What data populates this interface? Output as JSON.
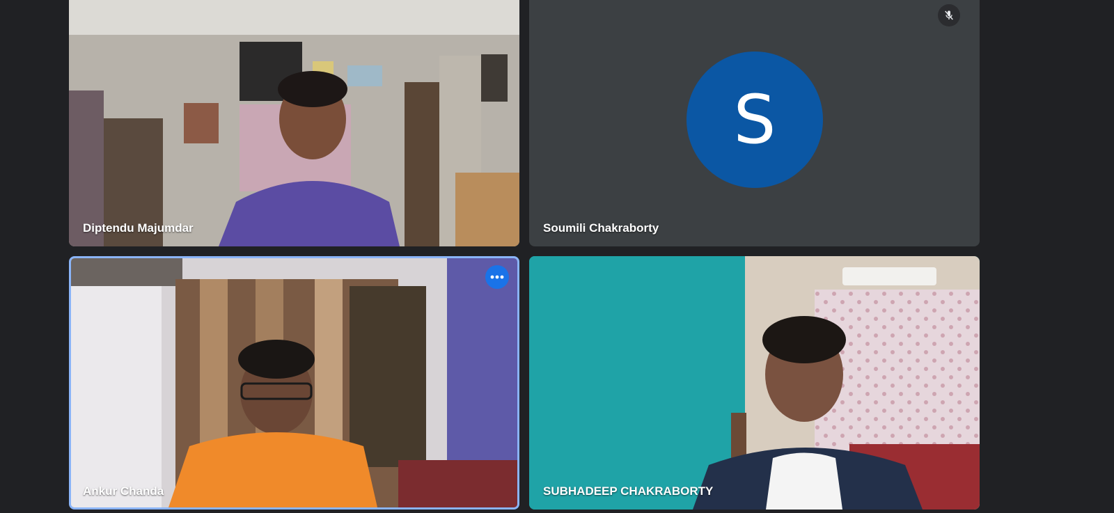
{
  "participants": [
    {
      "name": "Diptendu Majumdar"
    },
    {
      "name": "Soumili Chakraborty",
      "avatar_initial": "S",
      "muted": true
    },
    {
      "name": "Ankur Chanda",
      "active_speaker": true
    },
    {
      "name": "SUBHADEEP CHAKRABORTY"
    }
  ],
  "icons": {
    "mute": "mic-off-icon",
    "more": "more-options-icon"
  },
  "colors": {
    "background": "#202124",
    "tile_empty": "#3c4043",
    "avatar": "#0b57a4",
    "highlight_border": "#8ab4f8",
    "more_button": "#1a73e8"
  }
}
